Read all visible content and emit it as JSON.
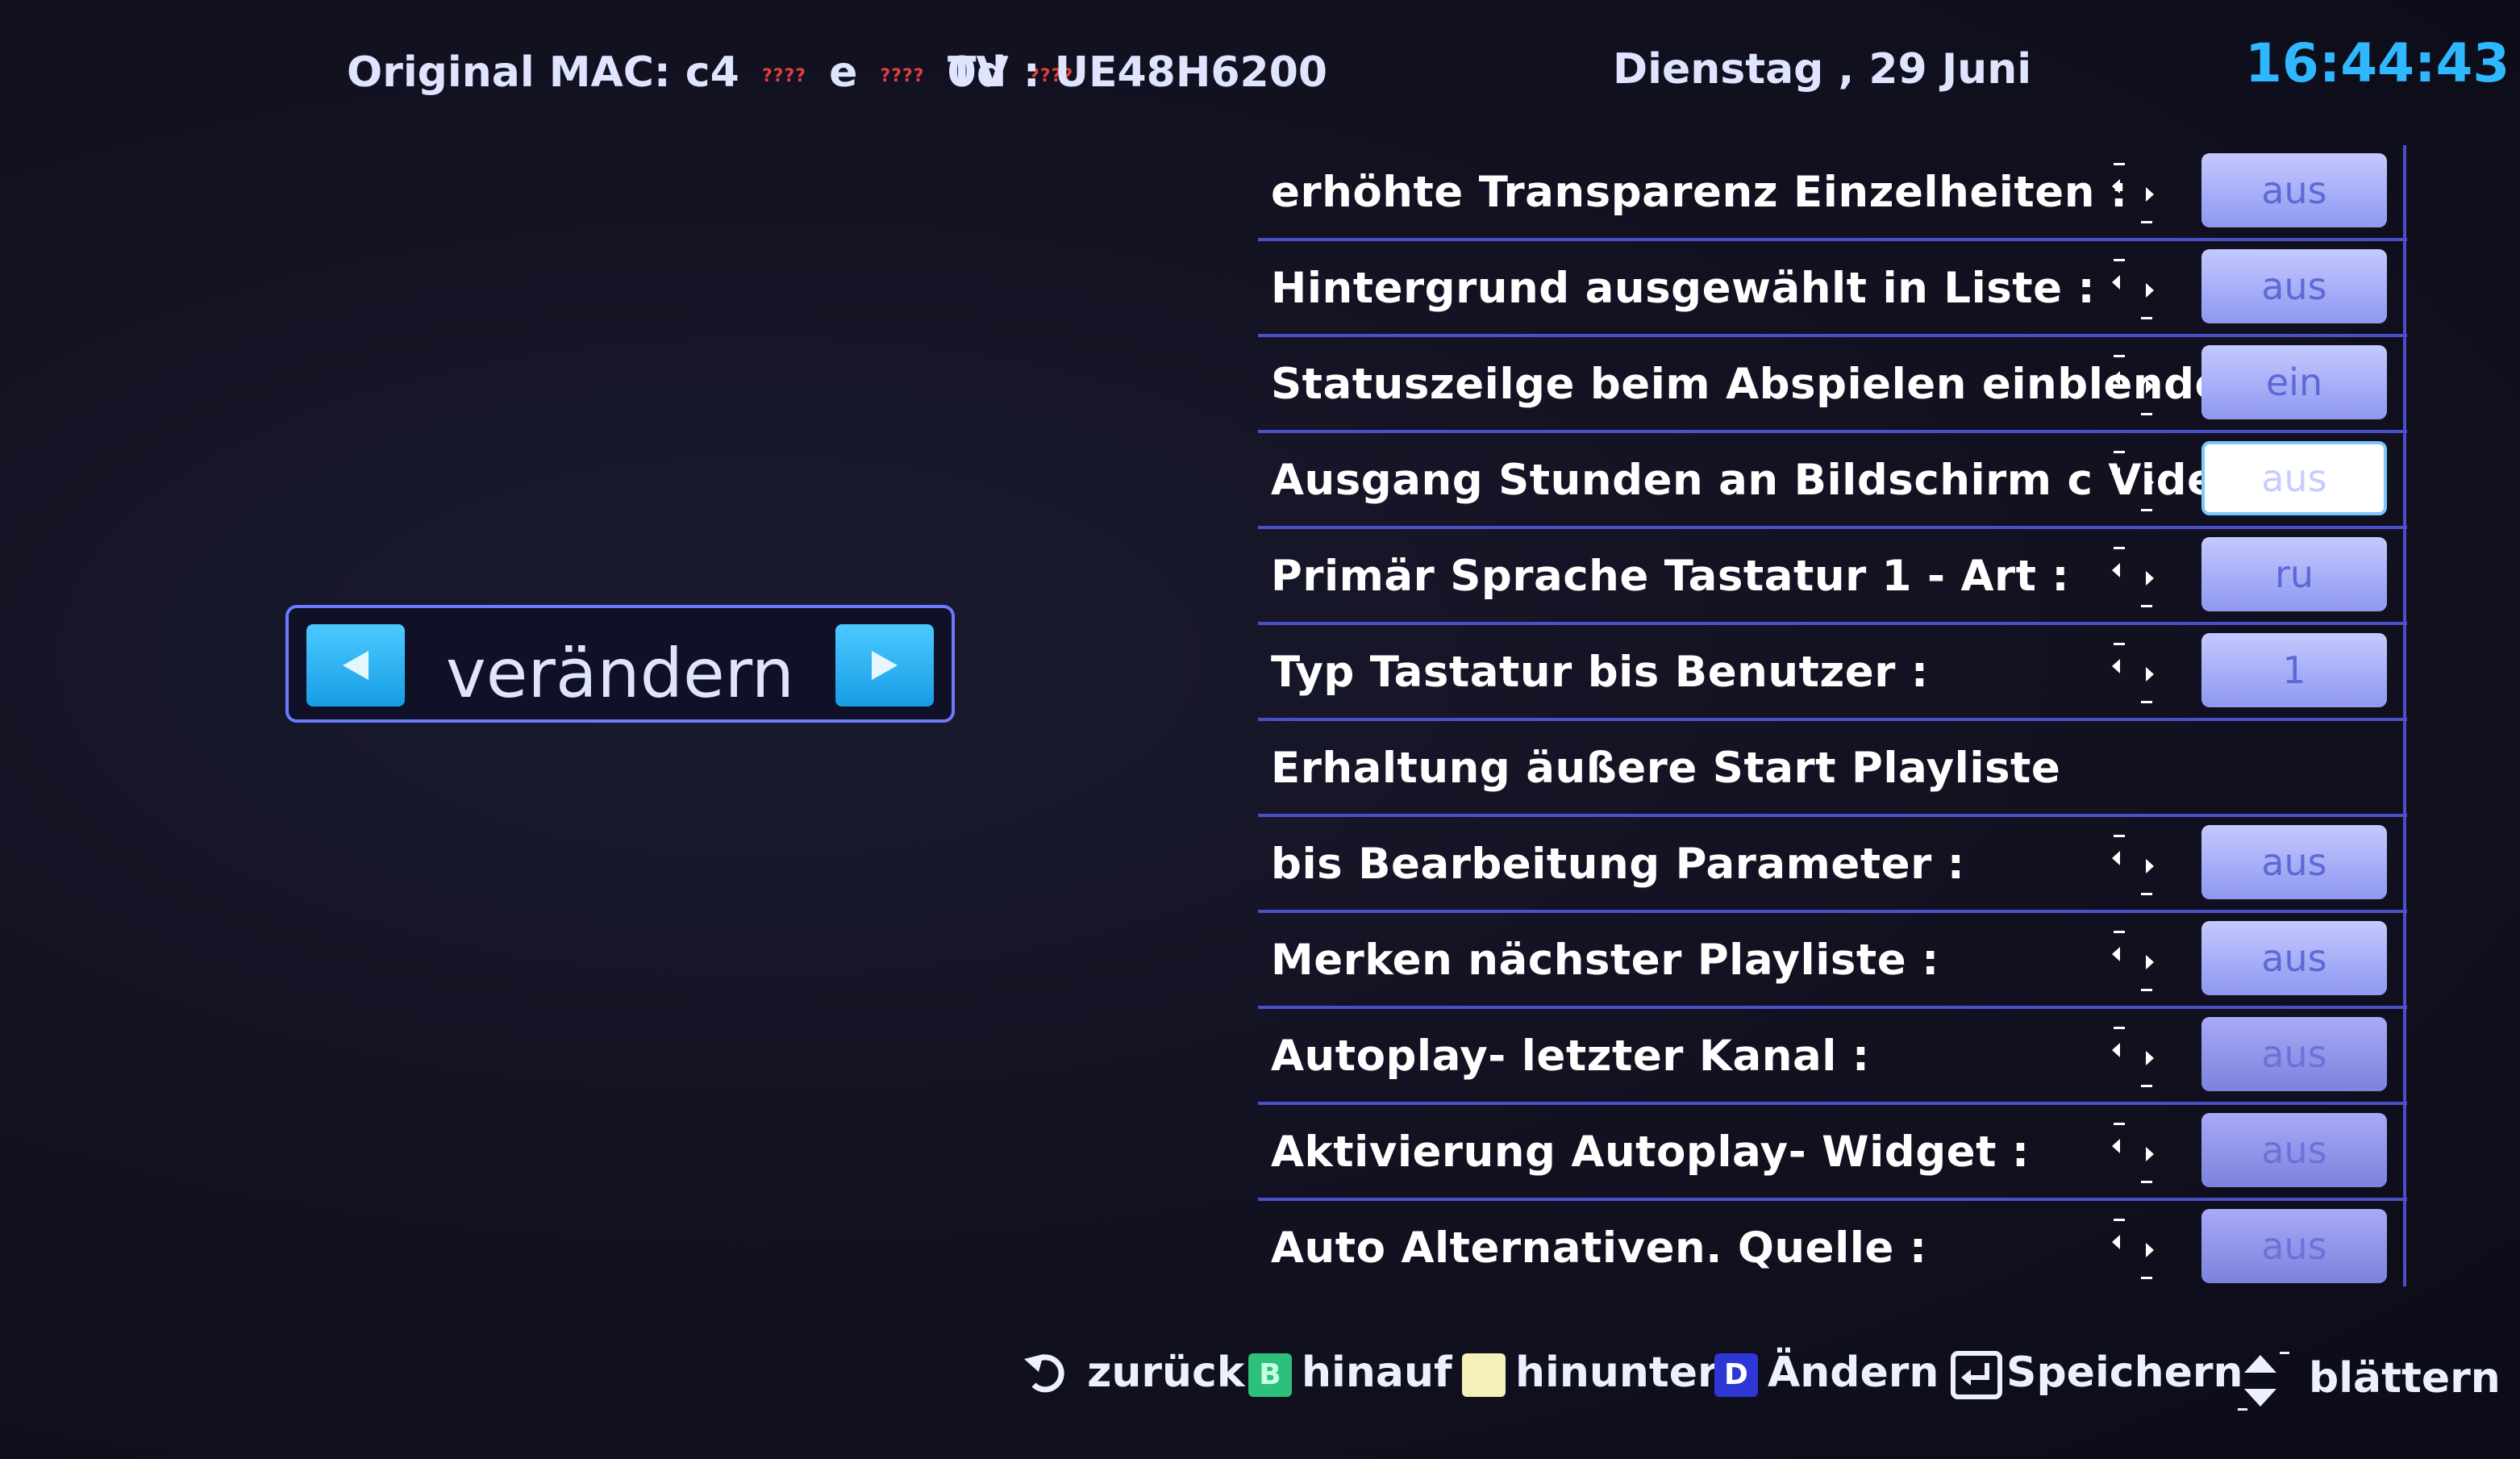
{
  "header": {
    "mac_label": "Original MAC: c4",
    "mac_mask": "????",
    "mac_part2": "e",
    "mac_part3": "0d",
    "tv": "TV : UE48H6200",
    "date": "Dienstag , 29 Juni",
    "clock": "16:44:43"
  },
  "change_widget": {
    "label": "verändern"
  },
  "settings": [
    {
      "label": "erhöhte  Transparenz  Einzelheiten :",
      "value": "aus",
      "state": "normal"
    },
    {
      "label": "Hintergrund  ausgewählt  in  Liste :",
      "value": "aus",
      "state": "normal"
    },
    {
      "label": "Statuszeilge beim Abspielen  einblenden :",
      "value": "ein",
      "state": "normal"
    },
    {
      "label": "Ausgang  Stunden  an  Bildschirm  c  Video",
      "value": "aus",
      "state": "selected"
    },
    {
      "label": "Primär  Sprache  Tastatur  1 - Art :",
      "value": "ru",
      "state": "normal"
    },
    {
      "label": "Typ  Tastatur  bis  Benutzer :",
      "value": "1",
      "state": "normal"
    },
    {
      "label": "Erhaltung  äußere  Start  Playliste",
      "value": "",
      "state": "header"
    },
    {
      "label": "bis  Bearbeitung  Parameter :",
      "value": "aus",
      "state": "normal"
    },
    {
      "label": "Merken  nächster  Playliste :",
      "value": "aus",
      "state": "normal"
    },
    {
      "label": "Autoplay-  letzter  Kanal :",
      "value": "aus",
      "state": "muted"
    },
    {
      "label": "Aktivierung  Autoplay-  Widget :",
      "value": "aus",
      "state": "muted"
    },
    {
      "label": "Auto  Alternativen.  Quelle :",
      "value": "aus",
      "state": "muted"
    }
  ],
  "footer": {
    "back": "zurück",
    "key_b": "B",
    "up": "hinauf",
    "down": "hinunter",
    "key_d": "D",
    "change": "Ändern",
    "save": "Speichern",
    "scroll": "blättern"
  },
  "colors": {
    "clock": "#2fb8ff",
    "accent": "#4b50c8",
    "value_bg": "#c4c9ff",
    "arrow_btn": "#179de6"
  }
}
